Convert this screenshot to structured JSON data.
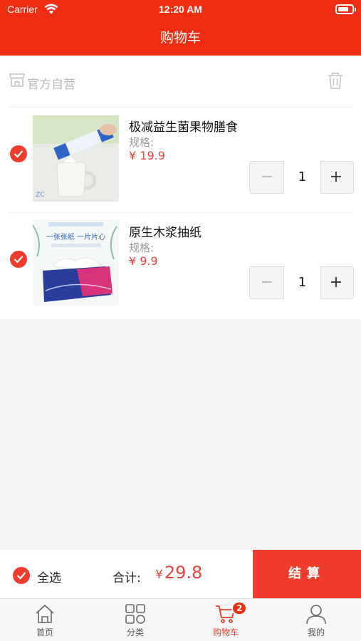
{
  "status_bar": {
    "carrier": "Carrier",
    "time": "12:20 AM"
  },
  "nav": {
    "title": "购物车"
  },
  "shop": {
    "name": "官方自营"
  },
  "items": [
    {
      "title": "极减益生菌果物膳食",
      "spec_label": "规格:",
      "price": "¥ 19.9",
      "quantity": "1",
      "checked": true,
      "thumb_watermark": "ZC"
    },
    {
      "title": "原生木浆抽纸",
      "spec_label": "规格:",
      "price": "¥ 9.9",
      "quantity": "1",
      "checked": true,
      "thumb_slogan": "一张张纸 一片片心"
    }
  ],
  "stepper": {
    "minus": "−",
    "plus": "+"
  },
  "checkout": {
    "select_all_label": "全选",
    "total_label": "合计:",
    "total_currency": "¥",
    "total_value": "29.8",
    "button_label": "结算"
  },
  "tabbar": {
    "tabs": [
      {
        "label": "首页",
        "icon": "home-icon"
      },
      {
        "label": "分类",
        "icon": "category-icon"
      },
      {
        "label": "购物车",
        "icon": "cart-icon",
        "active": true,
        "badge": "2"
      },
      {
        "label": "我的",
        "icon": "profile-icon"
      }
    ]
  },
  "colors": {
    "brand": "#ef2d12",
    "accent": "#ef3b2c",
    "price": "#e8403a",
    "background": "#f2f3f5"
  }
}
